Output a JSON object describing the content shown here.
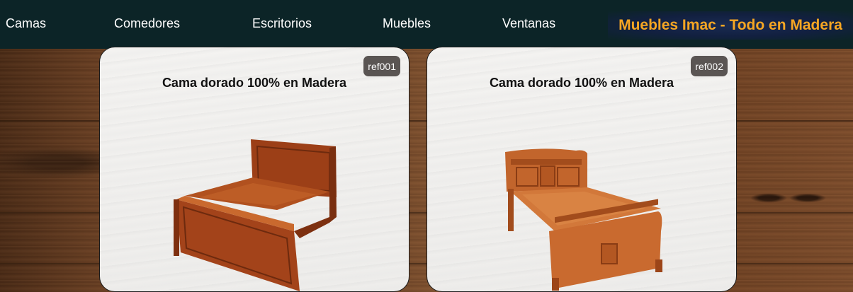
{
  "nav": {
    "items": [
      {
        "label": "Camas"
      },
      {
        "label": "Comedores"
      },
      {
        "label": "Escritorios"
      },
      {
        "label": "Muebles"
      },
      {
        "label": "Ventanas"
      }
    ],
    "brand": "Muebles Imac - Todo en Madera",
    "brand_color": "#f6a623",
    "background_color": "#0c2427"
  },
  "products": [
    {
      "ref": "ref001",
      "title": "Cama dorado 100% en Madera",
      "image_icon": "wooden-bed-image"
    },
    {
      "ref": "ref002",
      "title": "Cama dorado 100% en Madera",
      "image_icon": "wooden-bed-image"
    }
  ]
}
